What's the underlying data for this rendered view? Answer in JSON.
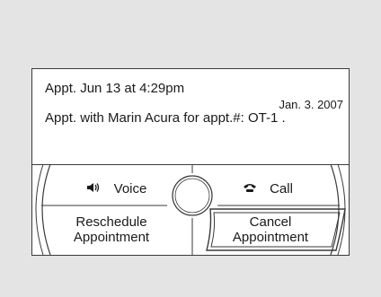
{
  "message": {
    "line1": "Appt. Jun  13 at  4:29pm",
    "date": "Jan. 3. 2007",
    "line2": "Appt. with Marin Acura for appt.#: OT-1 ."
  },
  "buttons": {
    "voice": {
      "label": "Voice",
      "icon": "speaker-icon"
    },
    "call": {
      "label": "Call",
      "icon": "phone-icon"
    },
    "reschedule": {
      "line1": "Reschedule",
      "line2": "Appointment"
    },
    "cancel": {
      "line1": "Cancel",
      "line2": "Appointment",
      "selected": true
    }
  },
  "colors": {
    "background": "#e4e4e4",
    "screen": "#ffffff",
    "outline": "#3a3a3a"
  }
}
